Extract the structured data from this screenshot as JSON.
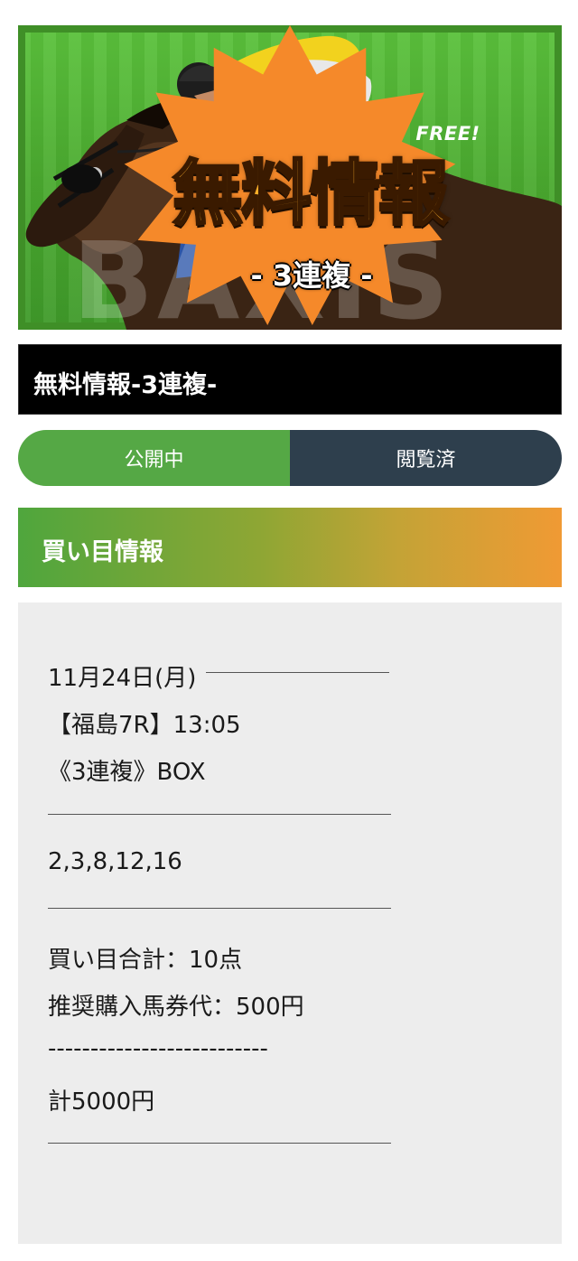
{
  "banner": {
    "badge": "FREE!",
    "title": "無料情報",
    "subtitle": "- 3連複 -",
    "watermark": "BAXIS",
    "colors": {
      "grass": "#4aa92f",
      "badge": "#f5892a",
      "title": "#ffb02a"
    }
  },
  "page_title": "無料情報-3連複-",
  "tabs": {
    "open_label": "公開中",
    "read_label": "閲覧済"
  },
  "section": {
    "heading": "買い目情報"
  },
  "content": {
    "date_line": "11月24日(月)",
    "race_line": "【福島7R】13:05",
    "bet_type": "《3連複》BOX",
    "numbers": "2,3,8,12,16",
    "total_points": "買い目合計：10点",
    "recommended_amount": "推奨購入馬券代：500円",
    "dashes": "--------------------------",
    "total_cost": "計5000円"
  }
}
